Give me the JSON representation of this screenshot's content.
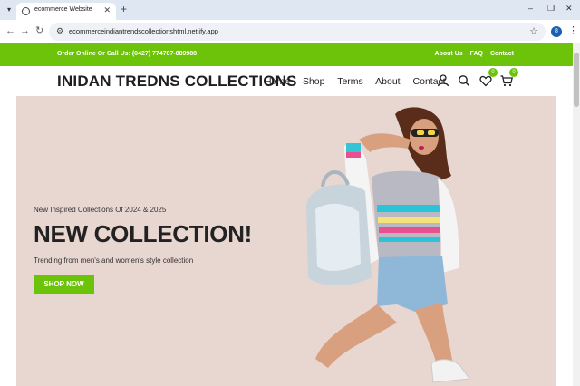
{
  "browser": {
    "tab_title": "ecommerce Website",
    "url": "ecommerceindiantrendscollectionshtml.netlify.app",
    "profile_initial": "8"
  },
  "topbar": {
    "contact_text": "Order Online Or Call Us: (0427) 774787-889988",
    "links": [
      "About Us",
      "FAQ",
      "Contact"
    ]
  },
  "header": {
    "logo": "INIDAN TREDNS COLLECTIONS",
    "menu": [
      "Home",
      "Shop",
      "Terms",
      "About",
      "Contact"
    ],
    "wishlist_count": "0",
    "cart_count": "0"
  },
  "hero": {
    "subtitle": "New Inspired Collections Of 2024 & 2025",
    "title": "NEW COLLECTION!",
    "description": "Trending from men's and women's style collection",
    "button_label": "SHOP NOW"
  },
  "colors": {
    "accent": "#6cc30a",
    "hero_bg": "#e8d6d1"
  }
}
